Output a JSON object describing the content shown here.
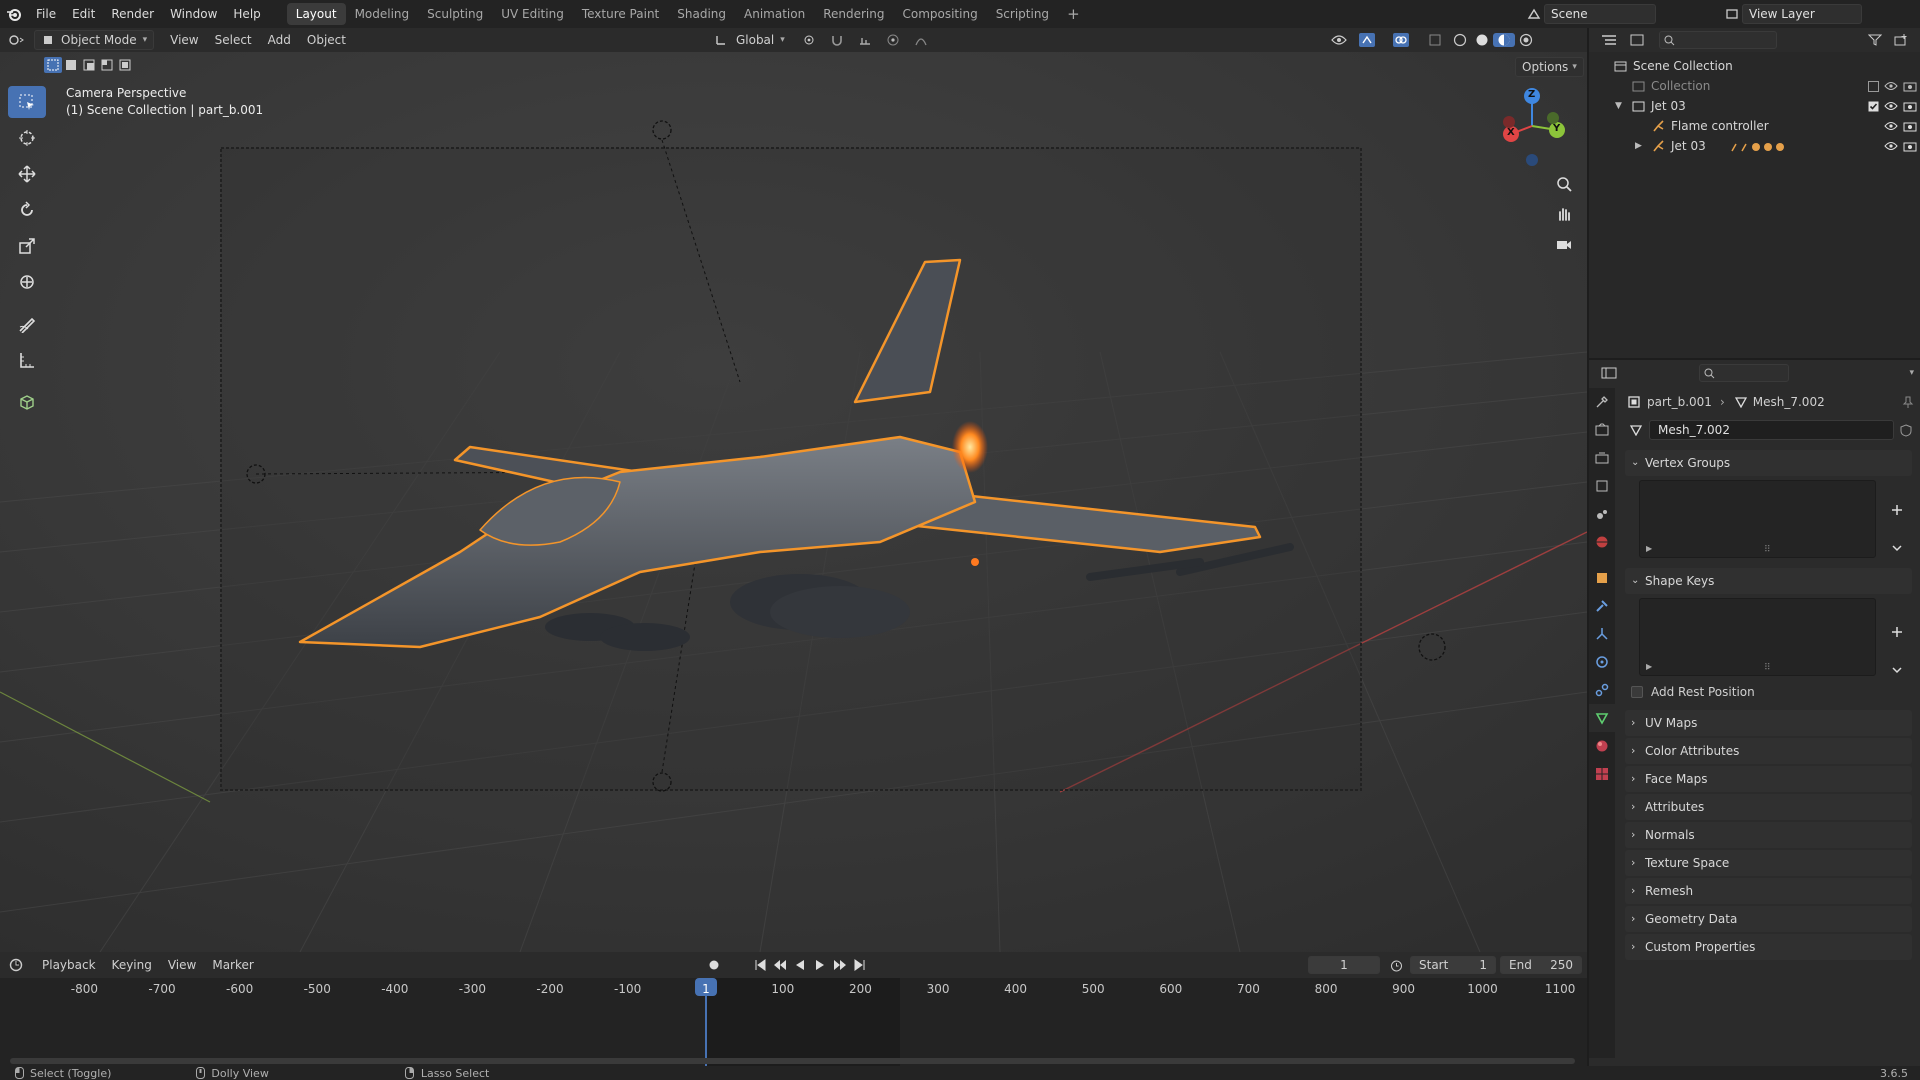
{
  "topbar": {
    "menus": [
      "File",
      "Edit",
      "Render",
      "Window",
      "Help"
    ],
    "workspaces": [
      "Layout",
      "Modeling",
      "Sculpting",
      "UV Editing",
      "Texture Paint",
      "Shading",
      "Animation",
      "Rendering",
      "Compositing",
      "Scripting"
    ],
    "active_workspace": "Layout",
    "add_tab": "+",
    "scene_label": "Scene",
    "view_layer_label": "View Layer"
  },
  "viewport_header": {
    "mode": "Object Mode",
    "menus": [
      "View",
      "Select",
      "Add",
      "Object"
    ],
    "transform_orientation": "Global",
    "options_label": "Options"
  },
  "viewport": {
    "title": "Camera Perspective",
    "subtitle": "(1) Scene Collection | part_b.001",
    "gizmo": {
      "x": "X",
      "y": "Y",
      "z": "Z"
    }
  },
  "toolbar": {
    "tools": [
      "select-box",
      "cursor",
      "move",
      "rotate",
      "scale",
      "transform",
      "annotate",
      "measure",
      "add-cube"
    ],
    "active": "select-box"
  },
  "outliner": {
    "root": "Scene Collection",
    "items": [
      {
        "label": "Collection",
        "level": 1,
        "dimmed": true
      },
      {
        "label": "Jet 03",
        "level": 1,
        "dimmed": false
      },
      {
        "label": "Flame controller",
        "level": 2,
        "dimmed": false
      },
      {
        "label": "Jet 03",
        "level": 2,
        "dimmed": false
      }
    ]
  },
  "properties": {
    "breadcrumb_object": "part_b.001",
    "breadcrumb_mesh": "Mesh_7.002",
    "mesh_name": "Mesh_7.002",
    "vertex_groups": "Vertex Groups",
    "shape_keys": "Shape Keys",
    "add_rest_position": "Add Rest Position",
    "panels": [
      "UV Maps",
      "Color Attributes",
      "Face Maps",
      "Attributes",
      "Normals",
      "Texture Space",
      "Remesh",
      "Geometry Data",
      "Custom Properties"
    ]
  },
  "timeline": {
    "menus": [
      "Playback",
      "Keying",
      "View",
      "Marker"
    ],
    "current_frame": "1",
    "start_label": "Start",
    "start": "1",
    "end_label": "End",
    "end": "250",
    "ticks": [
      "-800",
      "-700",
      "-600",
      "-500",
      "-400",
      "-300",
      "-200",
      "-100",
      "1",
      "100",
      "200",
      "300",
      "400",
      "500",
      "600",
      "700",
      "800",
      "900",
      "1000",
      "1100"
    ]
  },
  "statusbar": {
    "hint1": "Select (Toggle)",
    "hint2": "Dolly View",
    "hint3": "Lasso Select",
    "version": "3.6.5"
  },
  "colors": {
    "accent": "#4772b3",
    "selection_outline": "#f4952a",
    "x_axis": "#e04545",
    "y_axis": "#8cc43a",
    "z_axis": "#3f87e0"
  }
}
